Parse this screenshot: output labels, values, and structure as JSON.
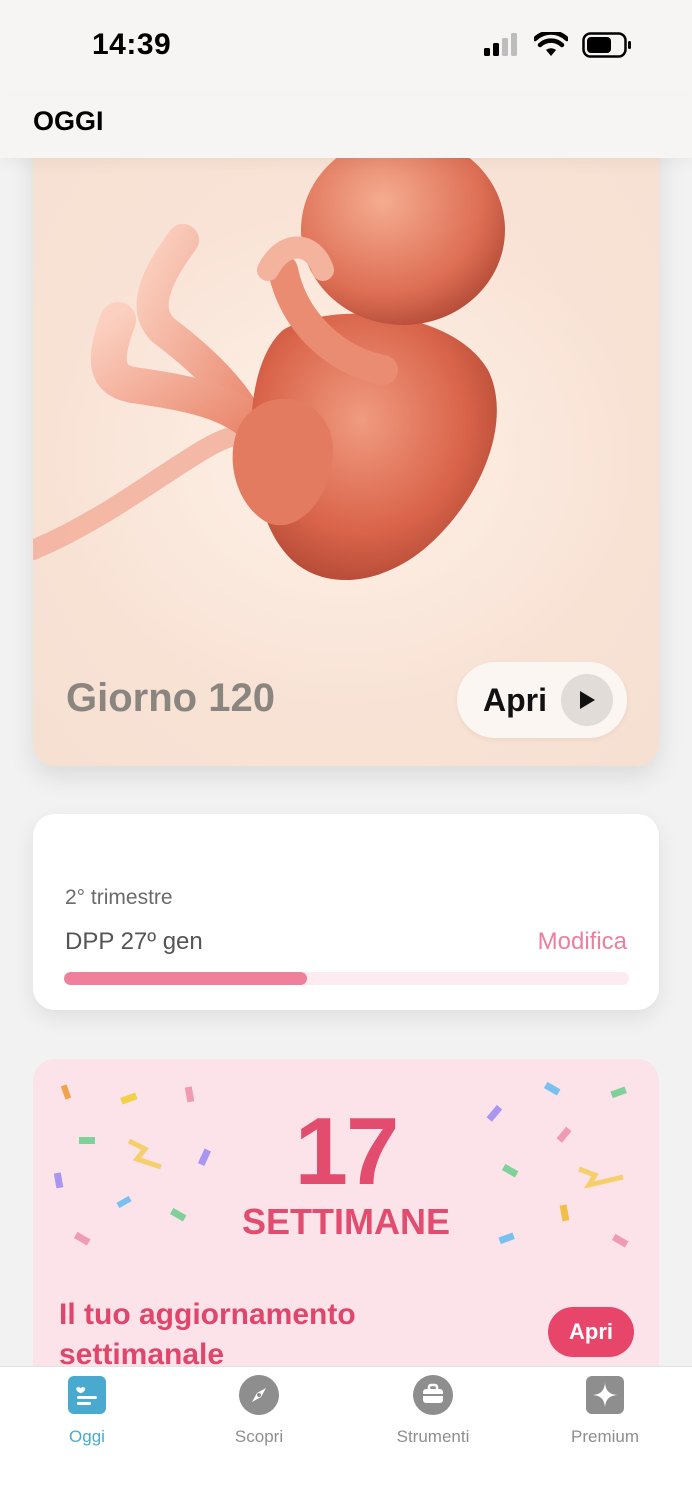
{
  "status_bar": {
    "time": "14:39"
  },
  "header": {
    "title": "OGGI"
  },
  "hero": {
    "day_label": "Giorno 120",
    "open_label": "Apri"
  },
  "progress": {
    "trimester": "2° trimestre",
    "due_date": "DPP 27º gen",
    "edit_label": "Modifica",
    "fraction": 0.43,
    "colors": {
      "fill": "#ef7f9b",
      "track": "#fcebf0"
    }
  },
  "weekly": {
    "number": "17",
    "unit": "SETTIMANE",
    "update_title": "Il tuo aggiornamento settimanale",
    "open_label": "Apri",
    "accent": "#e24c6f"
  },
  "tabs": [
    {
      "label": "Oggi",
      "icon": "today-icon",
      "active": true
    },
    {
      "label": "Scopri",
      "icon": "compass-icon",
      "active": false
    },
    {
      "label": "Strumenti",
      "icon": "toolbox-icon",
      "active": false
    },
    {
      "label": "Premium",
      "icon": "star-icon",
      "active": false
    }
  ]
}
